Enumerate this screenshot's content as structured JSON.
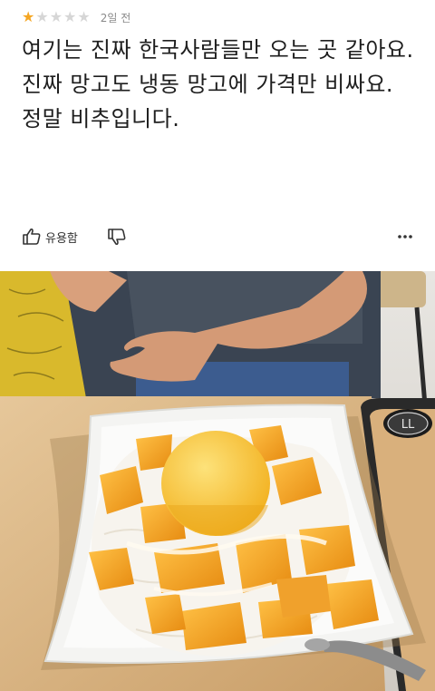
{
  "rating": {
    "value": 1,
    "max": 5,
    "time_ago": "2일 전",
    "star_color": "#f5a623"
  },
  "review": {
    "lines": [
      "여기는 진짜 한국사람들만 오는 곳 같아요.",
      "진짜 망고도 냉동 망고에 가격만 비싸요.",
      "정말 비추입니다."
    ]
  },
  "actions": {
    "helpful_label": "유용함",
    "icons": [
      "thumbs-up-icon",
      "thumbs-down-icon",
      "more-options-icon"
    ]
  },
  "photo": {
    "description_icon": "review-photo",
    "cup_label": "LL"
  }
}
